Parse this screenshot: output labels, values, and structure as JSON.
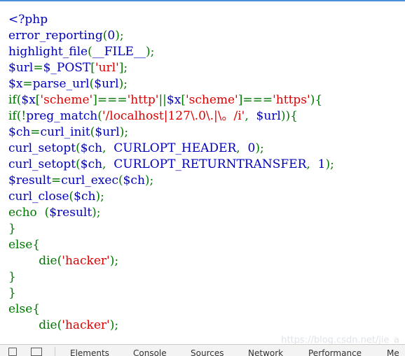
{
  "code_lines": [
    "<?php",
    "error_reporting(0);",
    "highlight_file(__FILE__);",
    "$url=$_POST['url'];",
    "$x=parse_url($url);",
    "if($x['scheme']==='http'||$x['scheme']==='https'){",
    "if(!preg_match('/localhost|127\\.0\\.|\\。/i', $url)){",
    "$ch=curl_init($url);",
    "curl_setopt($ch, CURLOPT_HEADER, 0);",
    "curl_setopt($ch, CURLOPT_RETURNTRANSFER, 1);",
    "$result=curl_exec($ch);",
    "curl_close($ch);",
    "echo ($result);",
    "}",
    "else{",
    "        die('hacker');",
    "}",
    "}",
    "else{",
    "        die('hacker');"
  ],
  "tokens": {
    "php_open": "<?php",
    "error_reporting": "error_reporting",
    "zero": "0",
    "highlight_file": "highlight_file",
    "file_const": "__FILE__",
    "url_var": "$url",
    "post_var": "$_POST",
    "url_str": "'url'",
    "x_var": "$x",
    "parse_url": "parse_url",
    "scheme_str": "'scheme'",
    "http_str": "'http'",
    "https_str": "'https'",
    "preg_match": "preg_match",
    "regex_str": "'/localhost|127\\.0\\.|\\。/i'",
    "ch_var": "$ch",
    "curl_init": "curl_init",
    "curl_setopt": "curl_setopt",
    "curlopt_header": "CURLOPT_HEADER",
    "curlopt_returntransfer": "CURLOPT_RETURNTRANSFER",
    "one": "1",
    "result_var": "$result",
    "curl_exec": "curl_exec",
    "curl_close": "curl_close",
    "echo": "echo",
    "else": "else",
    "die": "die",
    "hacker_str": "'hacker'"
  },
  "devtools": {
    "tabs": [
      "Elements",
      "Console",
      "Sources",
      "Network",
      "Performance",
      "Me"
    ]
  },
  "watermark": "https://blog.csdn.net/jie_a",
  "colors": {
    "keyword": "#007700",
    "default": "#0000bb",
    "string": "#dd0000"
  }
}
